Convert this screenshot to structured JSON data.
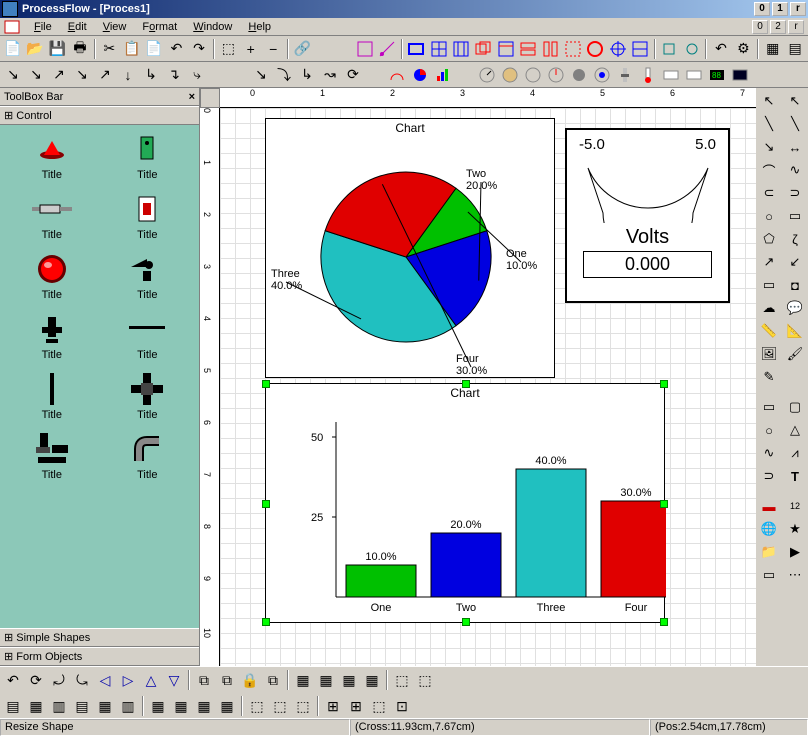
{
  "title": "ProcessFlow - [Proces1]",
  "menus": [
    "File",
    "Edit",
    "View",
    "Format",
    "Window",
    "Help"
  ],
  "toolbox": {
    "title": "ToolBox Bar",
    "sections": {
      "control": "Control",
      "simple": "Simple Shapes",
      "form": "Form Objects"
    },
    "items": [
      "Title",
      "Title",
      "Title",
      "Title",
      "Title",
      "Title",
      "Title",
      "Title",
      "Title",
      "Title",
      "Title",
      "Title"
    ]
  },
  "ruler_h": [
    "0",
    "1",
    "2",
    "3",
    "4",
    "5",
    "6",
    "7"
  ],
  "ruler_v": [
    "0",
    "1",
    "2",
    "3",
    "4",
    "5",
    "6",
    "7",
    "8",
    "9",
    "10"
  ],
  "gauge": {
    "min": "-5.0",
    "max": "5.0",
    "label": "Volts",
    "value": "0.000"
  },
  "chart_data": [
    {
      "type": "pie",
      "title": "Chart",
      "series": [
        {
          "name": "One",
          "value": 10,
          "label": "One 10.0%",
          "color": "#00c000"
        },
        {
          "name": "Two",
          "value": 20,
          "label": "Two 20.0%",
          "color": "#0000e0"
        },
        {
          "name": "Three",
          "value": 40,
          "label": "Three 40.0%",
          "color": "#20c0c0"
        },
        {
          "name": "Four",
          "value": 30,
          "label": "Four 30.0%",
          "color": "#e00000"
        }
      ]
    },
    {
      "type": "bar",
      "title": "Chart",
      "categories": [
        "One",
        "Two",
        "Three",
        "Four"
      ],
      "values": [
        10,
        20,
        40,
        30
      ],
      "labels": [
        "10.0%",
        "20.0%",
        "40.0%",
        "30.0%"
      ],
      "colors": [
        "#00c000",
        "#0000e0",
        "#20c0c0",
        "#e00000"
      ],
      "ylim": [
        0,
        50
      ],
      "yticks": [
        25,
        50
      ]
    }
  ],
  "status": {
    "action": "Resize Shape",
    "cross": "(Cross:11.93cm,7.67cm)",
    "pos": "(Pos:2.54cm,17.78cm)"
  }
}
